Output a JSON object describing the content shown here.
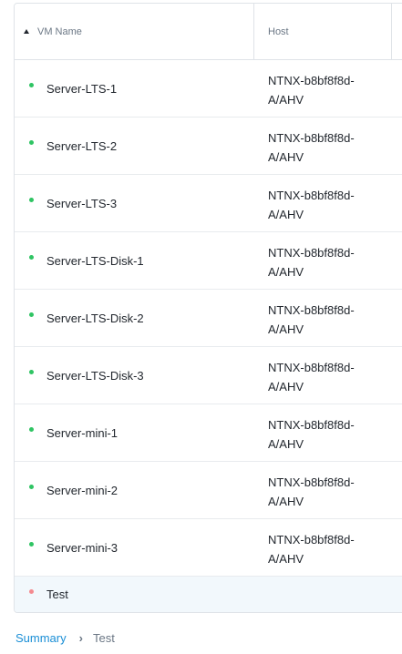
{
  "table": {
    "columns": {
      "name": "VM Name",
      "host": "Host"
    },
    "rows": [
      {
        "name": "Server-LTS-1",
        "host": "NTNX-b8bf8f8d-A/AHV",
        "status_color": "#2fc463"
      },
      {
        "name": "Server-LTS-2",
        "host": "NTNX-b8bf8f8d-A/AHV",
        "status_color": "#2fc463"
      },
      {
        "name": "Server-LTS-3",
        "host": "NTNX-b8bf8f8d-A/AHV",
        "status_color": "#2fc463"
      },
      {
        "name": "Server-LTS-Disk-1",
        "host": "NTNX-b8bf8f8d-A/AHV",
        "status_color": "#2fc463"
      },
      {
        "name": "Server-LTS-Disk-2",
        "host": "NTNX-b8bf8f8d-A/AHV",
        "status_color": "#2fc463"
      },
      {
        "name": "Server-LTS-Disk-3",
        "host": "NTNX-b8bf8f8d-A/AHV",
        "status_color": "#2fc463"
      },
      {
        "name": "Server-mini-1",
        "host": "NTNX-b8bf8f8d-A/AHV",
        "status_color": "#2fc463"
      },
      {
        "name": "Server-mini-2",
        "host": "NTNX-b8bf8f8d-A/AHV",
        "status_color": "#2fc463"
      },
      {
        "name": "Server-mini-3",
        "host": "NTNX-b8bf8f8d-A/AHV",
        "status_color": "#2fc463"
      },
      {
        "name": "Test",
        "host": "",
        "status_color": "#f48a8f",
        "selected": true
      }
    ]
  },
  "breadcrumb": {
    "link": "Summary",
    "separator": "›",
    "current": "Test"
  },
  "colors": {
    "accent": "#1b8fd6",
    "status_on": "#2fc463",
    "status_off": "#f48a8f",
    "selected_row": "#f2f8fc"
  }
}
